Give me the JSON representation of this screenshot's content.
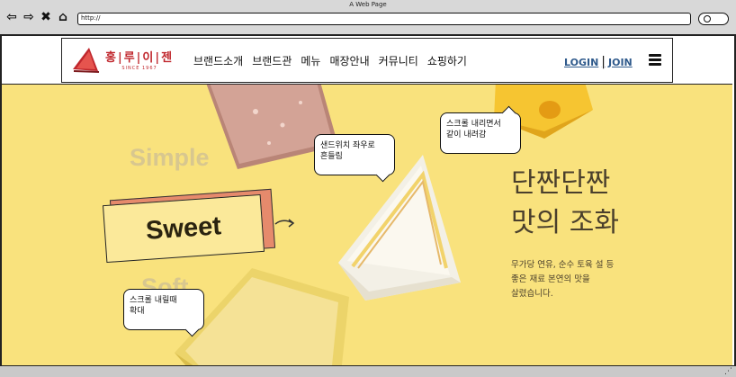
{
  "browser": {
    "window_title": "A Web Page",
    "url": "http://",
    "nav_icons": [
      "back-icon",
      "forward-icon",
      "close-icon",
      "home-icon"
    ]
  },
  "header": {
    "logo_name": "홍|루|이|젠",
    "logo_since": "SINCE 1967",
    "menu": [
      "브랜드소개",
      "브랜드관",
      "메뉴",
      "매장안내",
      "커뮤니티",
      "쇼핑하기"
    ],
    "login": "LOGIN",
    "separator": "|",
    "join": "JOIN"
  },
  "hero": {
    "word_simple": "Simple",
    "word_sweet": "Sweet",
    "word_soft": "Soft",
    "headline_line1": "단짠단짠",
    "headline_line2": "맛의 조화",
    "desc_line1": "무가당 연유, 순수 토육 설 등",
    "desc_line2": "좋은 재료 본연의 맛을",
    "desc_line3": "살렸습니다."
  },
  "notes": {
    "sandwich_note_line1": "샌드위치 좌우로",
    "sandwich_note_line2": "흔들림",
    "scroll_down_note_line1": "스크롤 내리면서",
    "scroll_down_note_line2": "같이 내려감",
    "scroll_zoom_note_line1": "스크롤 내릴때",
    "scroll_zoom_note_line2": "확대"
  },
  "colors": {
    "hero_bg": "#f9e27d",
    "brand_red": "#c0272d",
    "link_blue": "#2f5a8c",
    "sweet_shadow": "#e68a6c"
  }
}
